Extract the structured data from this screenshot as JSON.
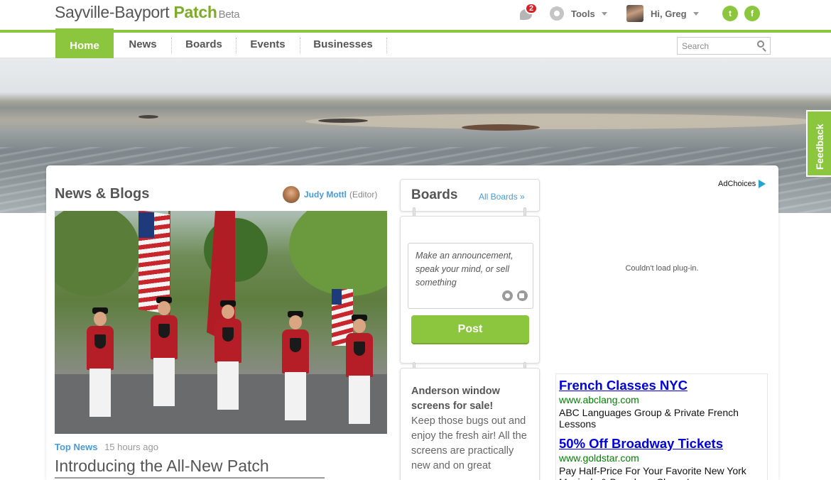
{
  "header": {
    "site_name": "Sayville-Bayport",
    "brand": "Patch",
    "beta": "Beta",
    "notifications_count": "2",
    "tools_label": "Tools",
    "greeting": "Hi, Greg",
    "twitter_glyph": "t",
    "facebook_glyph": "f"
  },
  "nav": {
    "items": [
      "Home",
      "News",
      "Boards",
      "Events",
      "Businesses"
    ],
    "active": "Home",
    "search_placeholder": "Search"
  },
  "feedback_label": "Feedback",
  "news": {
    "heading": "News & Blogs",
    "editor_name": "Judy Mottl",
    "editor_role": "(Editor)",
    "category": "Top News",
    "time": "15 hours ago",
    "headline": "Introducing the All-New Patch"
  },
  "boards": {
    "title": "Boards",
    "all_link": "All Boards »",
    "composer_placeholder": "Make an announcement, speak your mind, or sell something",
    "post_button": "Post",
    "announcement_title": "Anderson window screens for sale!",
    "announcement_body": "Keep those bugs out and enjoy the fresh air! All the screens are practically new and on great"
  },
  "ads": {
    "adchoices_label": "AdChoices",
    "plugin_message": "Couldn't load plug-in.",
    "items": [
      {
        "title": "French Classes NYC",
        "url": "www.abclang.com",
        "desc": "ABC Languages Group & Private French Lessons"
      },
      {
        "title": "50% Off Broadway Tickets",
        "url": "www.goldstar.com",
        "desc": "Pay Half-Price For Your Favorite New York Musicals & Broadway Shows!"
      }
    ]
  },
  "colors": {
    "brand_green": "#8cc63f",
    "link_blue": "#4a9ad8",
    "notification_red": "#d61f26",
    "ad_link": "#0000dd"
  },
  "icons": {
    "notifications": "speech-bubble-icon",
    "tools": "gear-icon",
    "search": "magnifier-icon",
    "twitter": "twitter-icon",
    "facebook": "facebook-icon",
    "camera": "camera-icon",
    "video": "video-icon",
    "adchoices": "adchoices-icon"
  }
}
